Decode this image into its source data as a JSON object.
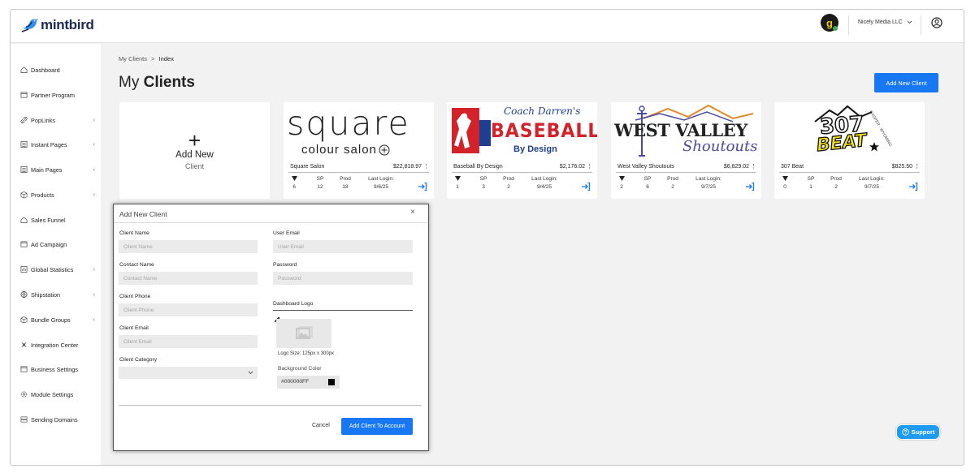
{
  "app": {
    "logo_text": "mintbird"
  },
  "header": {
    "account_name": "Nicely Media LLC",
    "avatar_letter": "g"
  },
  "sidebar": {
    "items": [
      {
        "label": "Dashboard",
        "icon": "home-icon",
        "has_chevron": false
      },
      {
        "label": "Partner Program",
        "icon": "window-icon",
        "has_chevron": false
      },
      {
        "label": "PopLinks",
        "icon": "link-icon",
        "has_chevron": true
      },
      {
        "label": "Instant Pages",
        "icon": "page-icon",
        "has_chevron": true
      },
      {
        "label": "Main Pages",
        "icon": "page-icon",
        "has_chevron": true
      },
      {
        "label": "Products",
        "icon": "box-icon",
        "has_chevron": true
      },
      {
        "label": "Sales Funnel",
        "icon": "home-icon",
        "has_chevron": false
      },
      {
        "label": "Ad Campaign",
        "icon": "window-icon",
        "has_chevron": false
      },
      {
        "label": "Global Statistics",
        "icon": "chart-icon",
        "has_chevron": true
      },
      {
        "label": "Shipstation",
        "icon": "globe-icon",
        "has_chevron": true
      },
      {
        "label": "Bundle Groups",
        "icon": "box-icon",
        "has_chevron": true
      },
      {
        "label": "Integration Center",
        "icon": "plug-icon",
        "has_chevron": false
      },
      {
        "label": "Business Settings",
        "icon": "window-icon",
        "has_chevron": false
      },
      {
        "label": "Module Settings",
        "icon": "gear-icon",
        "has_chevron": false
      },
      {
        "label": "Sending Domains",
        "icon": "server-icon",
        "has_chevron": false
      }
    ],
    "chevron": "‹"
  },
  "breadcrumb": {
    "parent": "My Clients",
    "sep": ">",
    "current": "Index"
  },
  "page": {
    "title_light": "My",
    "title_bold": "Clients",
    "add_button": "Add New Client"
  },
  "add_card": {
    "plus": "+",
    "line1": "Add New",
    "line2": "Client"
  },
  "stat_headers": {
    "sp": "SP",
    "prod": "Prod",
    "login": "Last Login:"
  },
  "clients": [
    {
      "name": "Square Salon",
      "amount": "$22,818.97",
      "menu": "⋮",
      "count": "6",
      "sp": "12",
      "prod": "18",
      "last_login": "9/6/25",
      "logo_line1": "square",
      "logo_line2": "colour salon"
    },
    {
      "name": "Baseball By Design",
      "amount": "$2,176.02",
      "menu": "⋮",
      "count": "1",
      "sp": "3",
      "prod": "2",
      "last_login": "9/4/25",
      "logo_line1": "BASEBALL",
      "logo_line2": "By Design",
      "logo_script": "Coach Darren's"
    },
    {
      "name": "West Valley Shoutouts",
      "amount": "$6,829.02",
      "menu": "⋮",
      "count": "2",
      "sp": "6",
      "prod": "2",
      "last_login": "9/7/25",
      "logo_line1": "WEST VALLEY",
      "logo_line2": "Shoutouts"
    },
    {
      "name": "307 Beat",
      "amount": "$825.50",
      "menu": "⋮",
      "count": "0",
      "sp": "1",
      "prod": "2",
      "last_login": "9/7/25",
      "logo_line1": "307",
      "logo_line2": "BEAT",
      "logo_arc": "CASPER · WYOMING"
    }
  ],
  "modal": {
    "title": "Add New Client",
    "close": "×",
    "fields": {
      "client_name": {
        "label": "Client Name",
        "placeholder": "Client Name"
      },
      "contact_name": {
        "label": "Contact Name",
        "placeholder": "Contact Name"
      },
      "client_phone": {
        "label": "Client Phone",
        "placeholder": "Client Phone"
      },
      "client_email": {
        "label": "Client Email",
        "placeholder": "Client Email"
      },
      "client_category": {
        "label": "Client Category",
        "value": ""
      },
      "user_email": {
        "label": "User Email",
        "placeholder": "User Email"
      },
      "password": {
        "label": "Password",
        "placeholder": "Password"
      }
    },
    "dashboard_logo_label": "Dashboard Logo",
    "logo_size": "Logo Size: 125px x 300px",
    "bg_color_label": "Background Color",
    "bg_color_value": "#000000FF",
    "cancel": "Cancel",
    "submit": "Add Client To Account"
  },
  "support": {
    "label": "Support"
  },
  "colors": {
    "primary": "#1877f2",
    "support": "#1e9bf0",
    "baseball_red": "#d3222a",
    "baseball_blue": "#1d3f8f",
    "west_valley_purple": "#4b4aa0"
  }
}
